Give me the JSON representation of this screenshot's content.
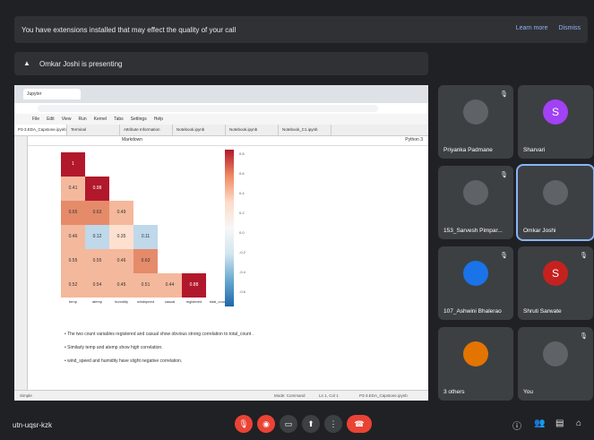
{
  "banner": {
    "message": "You have extensions installed that may effect the quality of your call",
    "learn_more": "Learn more",
    "dismiss": "Dismiss"
  },
  "presenting": {
    "text": "Omkar Joshi is presenting"
  },
  "shared_screen": {
    "browser_tab": "Jupyter",
    "menus": [
      "File",
      "Edit",
      "View",
      "Run",
      "Kernel",
      "Tabs",
      "Settings",
      "Help"
    ],
    "notebook_tabs": [
      "P3-3.EDA_Capstone.ipynb",
      "Terminal",
      "Attribute Information",
      "Notebook.ipynb",
      "Notebook.ipynb",
      "Notebook_C1.ipynb"
    ],
    "kernel": "Python 3",
    "cell_type": "Markdown",
    "heatmap_values": [
      [
        "1"
      ],
      [
        "0.41",
        "0.98"
      ],
      [
        "0.65",
        "0.63",
        "0.49"
      ],
      [
        "0.46",
        "0.12",
        "0.35",
        "0.11"
      ],
      [
        "0.55",
        "0.55",
        "0.46",
        "0.63"
      ],
      [
        "0.52",
        "0.54",
        "0.45",
        "0.51",
        "0.44",
        "0.88"
      ]
    ],
    "colorbar_ticks": [
      "0.8",
      "0.6",
      "0.4",
      "0.2",
      "0.0",
      "-0.2",
      "-0.4",
      "-0.6"
    ],
    "x_labels": [
      "temp",
      "atemp",
      "humidity",
      "windspeed",
      "casual",
      "registered",
      "total_count"
    ],
    "bullets": [
      "The two count variables  registered  and  casual  show obvious strong correlation to  total_count .",
      "Similarly  temp  and  atemp  show high correlation.",
      "wind_speed  and  humidity  have slight negative correlation."
    ],
    "status": "Simple",
    "status_mode": "Mode: Command",
    "status_pos": "Ln 1, Col 1",
    "status_file": "P3-3.EDA_Capstone.ipynb"
  },
  "participants": [
    {
      "name": "Priyanka Padmane",
      "avatar_color": "#5f6368",
      "initial": "",
      "muted": true
    },
    {
      "name": "Sharvari",
      "avatar_color": "#a142f4",
      "initial": "S",
      "muted": false
    },
    {
      "name": "153_Sarvesh Pimpar...",
      "avatar_color": "#5f6368",
      "initial": "",
      "muted": true
    },
    {
      "name": "Omkar Joshi",
      "avatar_color": "#5f6368",
      "initial": "",
      "muted": false
    },
    {
      "name": "107_Ashwini Bhalerao",
      "avatar_color": "#1a73e8",
      "initial": "",
      "muted": true
    },
    {
      "name": "Shruti Sarwate",
      "avatar_color": "#c5221f",
      "initial": "S",
      "muted": true
    },
    {
      "name": "3 others",
      "avatar_color": "#e37400",
      "initial": "",
      "muted": false
    },
    {
      "name": "You",
      "avatar_color": "#5f6368",
      "initial": "",
      "muted": true
    }
  ],
  "meeting_code": "utn-uqsr-kzk",
  "colors": {
    "end_call": "#ea4335",
    "accent": "#8ab4f8",
    "muted": "#ea4335"
  },
  "icons": [
    "mic-off-icon",
    "camera-off-icon",
    "captions-icon",
    "present-icon",
    "more-icon",
    "end-call-icon",
    "info-icon",
    "people-icon",
    "chat-icon",
    "activities-icon"
  ]
}
